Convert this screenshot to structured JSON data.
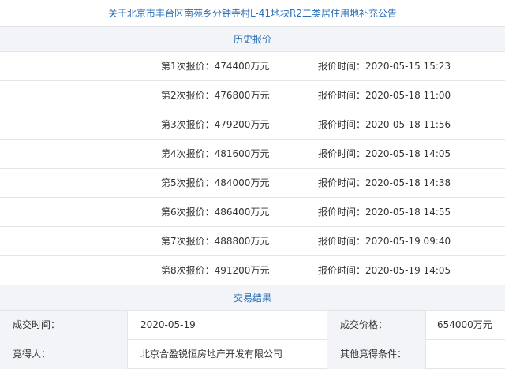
{
  "notice": {
    "title": "关于北京市丰台区南苑乡分钟寺村L-41地块R2二类居住用地补充公告"
  },
  "history": {
    "header": "历史报价",
    "bids": [
      {
        "label": "第1次报价：474400万元",
        "time": "报价时间：2020-05-15 15:23"
      },
      {
        "label": "第2次报价：476800万元",
        "time": "报价时间：2020-05-18 11:00"
      },
      {
        "label": "第3次报价：479200万元",
        "time": "报价时间：2020-05-18 11:56"
      },
      {
        "label": "第4次报价：481600万元",
        "time": "报价时间：2020-05-18 14:05"
      },
      {
        "label": "第5次报价：484000万元",
        "time": "报价时间：2020-05-18 14:38"
      },
      {
        "label": "第6次报价：486400万元",
        "time": "报价时间：2020-05-18 14:55"
      },
      {
        "label": "第7次报价：488800万元",
        "time": "报价时间：2020-05-19 09:40"
      },
      {
        "label": "第8次报价：491200万元",
        "time": "报价时间：2020-05-19 14:05"
      }
    ]
  },
  "result": {
    "header": "交易结果",
    "rows": [
      {
        "label1": "成交时间：",
        "value1": "2020-05-19",
        "label2": "成交价格：",
        "value2": "654000万元"
      },
      {
        "label1": "竞得人：",
        "value1": "北京合盈锐恒房地产开发有限公司",
        "label2": "其他竞得条件：",
        "value2": ""
      }
    ]
  }
}
